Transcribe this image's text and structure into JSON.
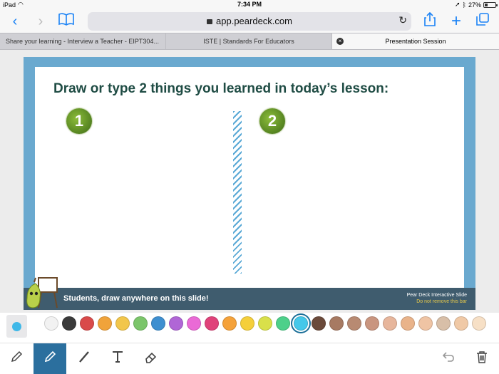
{
  "status": {
    "device": "iPad",
    "time": "7:34 PM",
    "battery": "27%"
  },
  "browser": {
    "url": "app.peardeck.com",
    "tabs": [
      {
        "label": "Share your learning - Interview a Teacher - EIPT304..."
      },
      {
        "label": "ISTE | Standards For Educators"
      },
      {
        "label": "Presentation Session"
      }
    ]
  },
  "slide": {
    "title": "Draw or type 2 things you learned in today’s lesson:",
    "badge1": "1",
    "badge2": "2",
    "footer_message": "Students, draw anywhere on this slide!",
    "brand_line1": "Pear Deck Interactive Slide",
    "brand_line2": "Do not remove this bar"
  },
  "palette": {
    "selected_index": 14,
    "colors": [
      "#f2f2f2",
      "#3a3a3a",
      "#d94a4a",
      "#f0a33a",
      "#f2c64a",
      "#7bc56a",
      "#3e8fd0",
      "#b066d6",
      "#ea6ad6",
      "#e0427a",
      "#f5a23a",
      "#f5cf3a",
      "#d9e04a",
      "#4ed08a",
      "#44c8ea",
      "#6b4a3a",
      "#a77a62",
      "#b88a72",
      "#c9957f",
      "#e7b69c",
      "#e9b38a",
      "#efc4a4",
      "#d8bfa8",
      "#f0c9a6",
      "#f7e0c6"
    ]
  },
  "tools": [
    "pencil-tool",
    "marker-tool",
    "line-tool",
    "text-tool",
    "eraser-tool",
    "undo-tool",
    "trash-tool"
  ]
}
